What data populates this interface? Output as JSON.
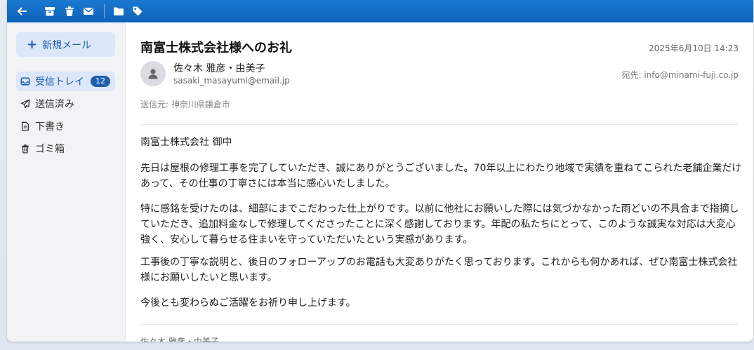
{
  "toolbar": {
    "icons": [
      "back-arrow-icon",
      "archive-icon",
      "trash-icon",
      "envelope-icon",
      "folder-icon",
      "tag-icon"
    ]
  },
  "sidebar": {
    "compose_plus": "+",
    "compose_label": "新規メール",
    "items": [
      {
        "label": "受信トレイ",
        "badge": "12",
        "icon": "inbox-icon"
      },
      {
        "label": "送信済み",
        "icon": "paper-plane-icon"
      },
      {
        "label": "下書き",
        "icon": "document-icon"
      },
      {
        "label": "ゴミ箱",
        "icon": "trash-icon"
      }
    ]
  },
  "email": {
    "subject": "南富士株式会社様へのお礼",
    "date": "2025年6月10日 14:23",
    "sender_name": "佐々木 雅彦・由美子",
    "sender_email": "sasaki_masayumi@email.jp",
    "recipient": "宛先: info@minami-fuji.co.jp",
    "origin": "送信元: 神奈川県鎌倉市",
    "paragraphs": [
      "南富士株式会社 御中",
      "先日は屋根の修理工事を完了していただき、誠にありがとうございました。70年以上にわたり地域で実績を重ねてこられた老舗企業だけあって、その仕事の丁寧さには本当に感心いたしました。",
      "特に感銘を受けたのは、細部にまでこだわった仕上がりです。以前に他社にお願いした際には気づかなかった雨どいの不具合まで指摘していただき、追加料金なしで修理してくださったことに深く感謝しております。年配の私たちにとって、このような誠実な対応は大変心強く、安心して暮らせる住まいを守っていただいたという実感があります。",
      "工事後の丁寧な説明と、後日のフォローアップのお電話も大変ありがたく思っております。これからも何かあれば、ぜひ南富士株式会社様にお願いしたいと思います。",
      "今後とも変わらぬご活躍をお祈り申し上げます。"
    ],
    "signature": "佐々木 雅彦・由美子"
  },
  "colors": {
    "toolbar": "#0d62b8",
    "accent": "#1f5fae",
    "active_bg": "#dce8fa",
    "sidebar_bg": "#f2f3f5"
  }
}
